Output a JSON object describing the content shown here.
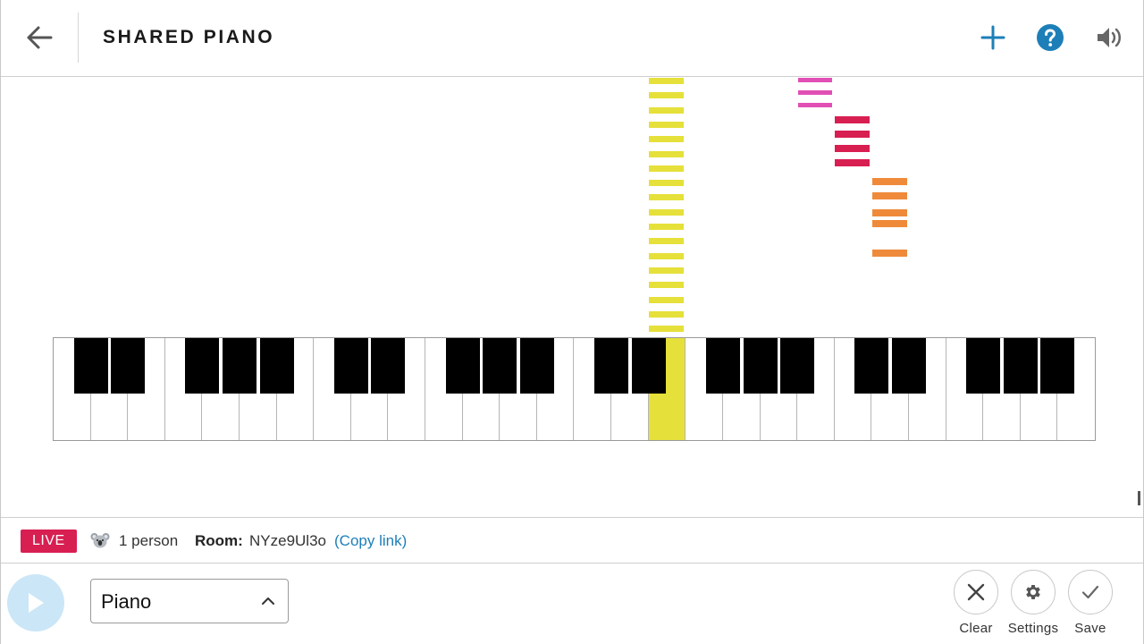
{
  "header": {
    "title": "SHARED PIANO",
    "back_icon": "arrow-left-icon",
    "add_icon": "plus-icon",
    "help_icon": "question-circle-icon",
    "sound_icon": "speaker-icon",
    "accent_color": "#1d7fb8"
  },
  "status": {
    "live_label": "LIVE",
    "live_color": "#d81f52",
    "avatar_icon": "koala-icon",
    "people_count": "1 person",
    "room_label": "Room:",
    "room_id": "NYze9Ul3o",
    "copy_link": "(Copy link)"
  },
  "controls": {
    "play_icon": "play-icon",
    "instrument": "Piano",
    "clear_label": "Clear",
    "settings_label": "Settings",
    "save_label": "Save"
  },
  "note_colors": [
    "#e6e03a",
    "#e14fb5",
    "#d81f52",
    "#ef8a3a"
  ],
  "active_key_color": "#e6e03a"
}
